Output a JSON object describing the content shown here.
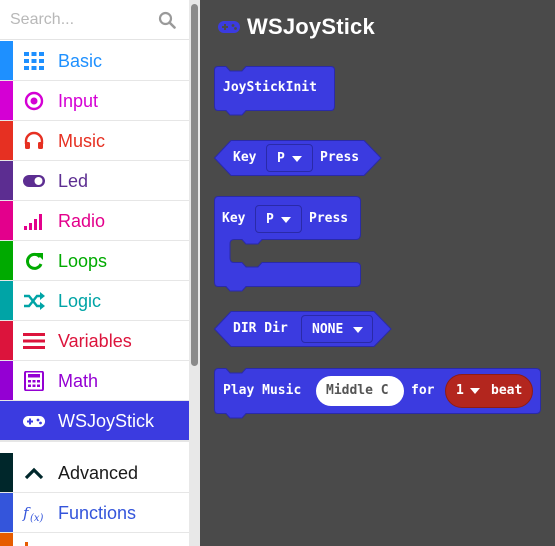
{
  "search": {
    "placeholder": "Search..."
  },
  "categories": [
    {
      "label": "Basic",
      "color": "#1e90ff",
      "icon": "grid-icon"
    },
    {
      "label": "Input",
      "color": "#d400d4",
      "icon": "radio-dot-icon"
    },
    {
      "label": "Music",
      "color": "#e63022",
      "icon": "headphones-icon"
    },
    {
      "label": "Led",
      "color": "#5c2d91",
      "icon": "toggle-icon"
    },
    {
      "label": "Radio",
      "color": "#e3008c",
      "icon": "signal-bars-icon"
    },
    {
      "label": "Loops",
      "color": "#00aa00",
      "icon": "loop-arrow-icon"
    },
    {
      "label": "Logic",
      "color": "#00a4a6",
      "icon": "shuffle-icon"
    },
    {
      "label": "Variables",
      "color": "#dc143c",
      "icon": "lines-icon"
    },
    {
      "label": "Math",
      "color": "#9400d3",
      "icon": "calculator-icon"
    },
    {
      "label": "WSJoyStick",
      "color": "#3b3be0",
      "icon": "gamepad-icon"
    }
  ],
  "advanced": [
    {
      "label": "Advanced",
      "color": "#00272b",
      "icon": "chevron-up-icon"
    },
    {
      "label": "Functions",
      "color": "#3455db",
      "icon": "function-icon"
    }
  ],
  "flyout": {
    "title": "WSJoyStick",
    "accent": "#3b3be0",
    "blocks": {
      "init": "JoyStickInit",
      "key_hex": {
        "key": "Key",
        "value": "P",
        "press": "Press"
      },
      "key_event": {
        "key": "Key",
        "value": "P",
        "press": "Press"
      },
      "dir": {
        "label": "DIR Dir",
        "value": "NONE"
      },
      "play": {
        "label": "Play Music",
        "note": "Middle C",
        "for": "for",
        "beats": "1",
        "unit": "beat"
      }
    }
  }
}
